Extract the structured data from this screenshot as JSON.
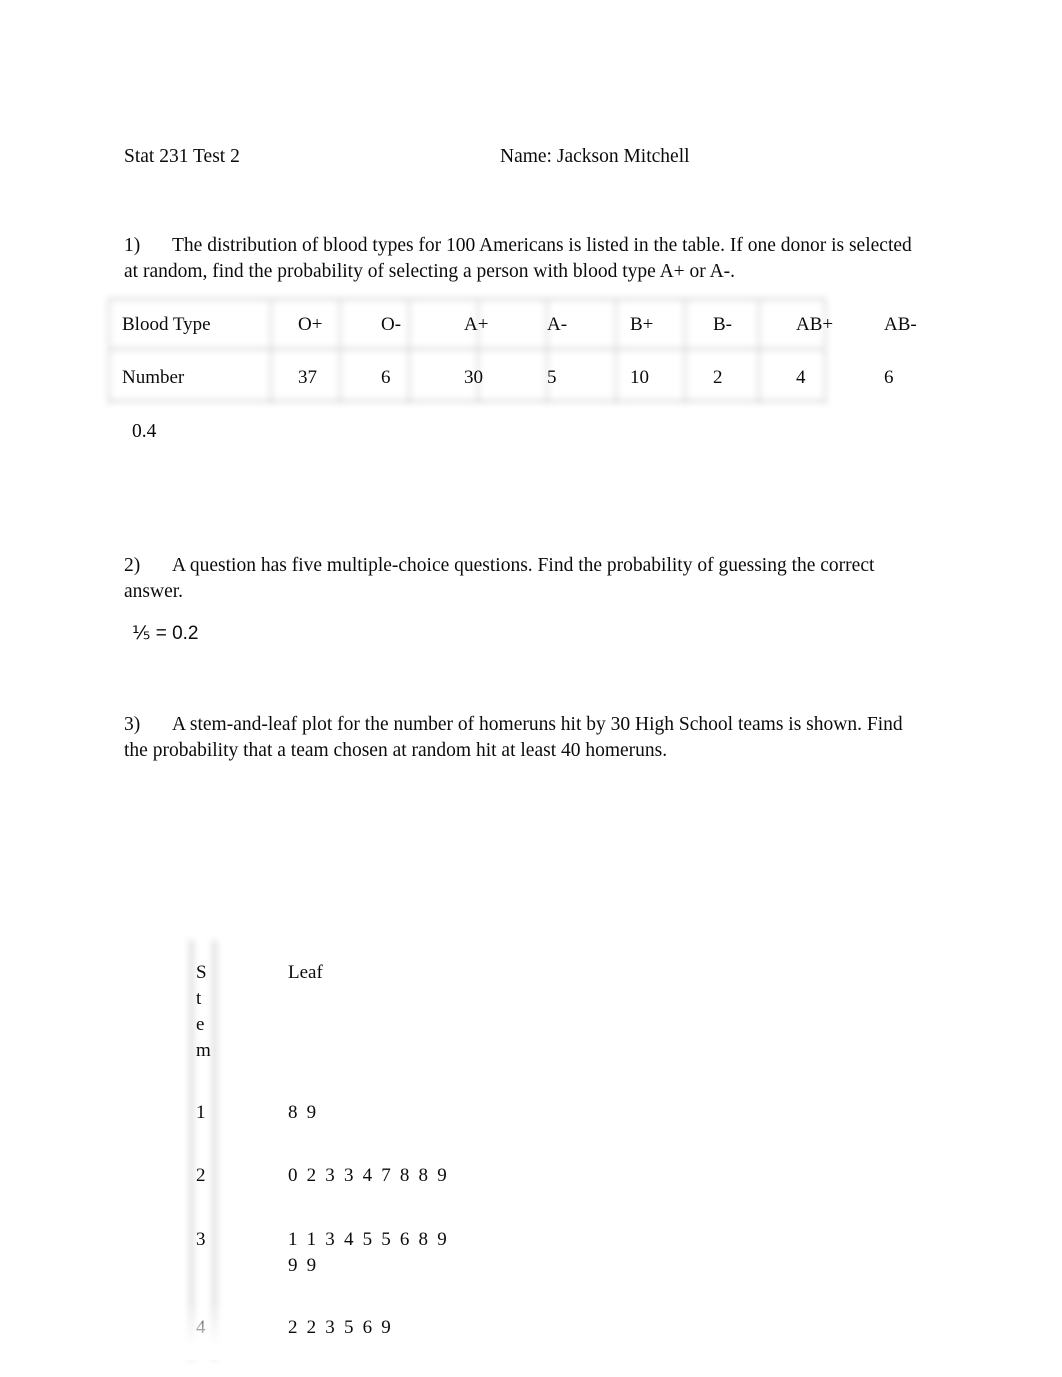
{
  "document": {
    "header": {
      "left": "Stat 231 Test 2",
      "right": "Name: Jackson Mitchell"
    }
  },
  "questions": [
    {
      "number": "1)",
      "text": "The distribution of blood types for 100 Americans is listed in the table. If one donor is selected at random, find the probability of selecting a person with blood type A+ or A-.",
      "answer": "0.4"
    },
    {
      "number": "2)",
      "text": "A question has five multiple-choice questions. Find the probability of guessing the correct answer.",
      "answer": "⅕ = 0.2"
    },
    {
      "number": "3)",
      "text": "A stem-and-leaf plot for the number of homeruns hit by 30 High School teams is shown. Find the probability that a team chosen at random hit at least 40 homeruns."
    }
  ],
  "blood_table": {
    "row_labels": [
      "Blood Type",
      "Number"
    ],
    "types": [
      "O+",
      "O-",
      "A+",
      "A-",
      "B+",
      "B-",
      "AB+",
      "AB-"
    ],
    "counts": [
      "37",
      "6",
      "30",
      "5",
      "10",
      "2",
      "4",
      "6"
    ]
  },
  "stem_leaf": {
    "stem_header": "Stem",
    "stem_header_chars": [
      "S",
      "t",
      "e",
      "m"
    ],
    "leaf_header": "Leaf",
    "rows": [
      {
        "stem": "1",
        "leaf": "8 9"
      },
      {
        "stem": "2",
        "leaf": "0 2 3 3 4 7 8 8 9"
      },
      {
        "stem": "3",
        "leaf": "1 1 3 4 5 5 6 8 9\n9 9"
      },
      {
        "stem": "4",
        "leaf": "2 2 3 5 6 9"
      }
    ]
  }
}
